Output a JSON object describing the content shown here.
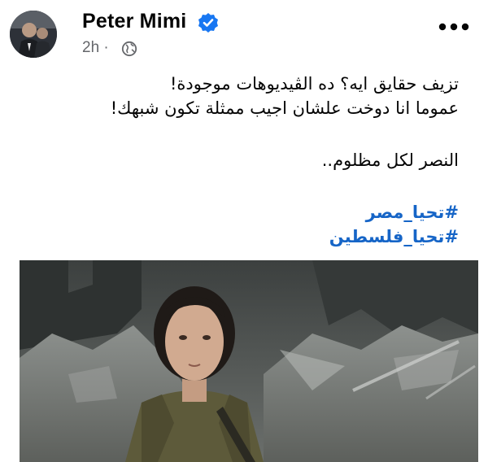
{
  "post": {
    "author_name": "Peter Mimi",
    "time": "2h",
    "separator": "·",
    "lines": [
      "تزيف حقايق ايه؟ ده الڤيديوهات موجودة!",
      "عموما انا دوخت علشان اجيب ممثلة تكون شبهك!"
    ],
    "closing": "النصر لكل مظلوم..",
    "hashtags": [
      "#تحيا_مصر",
      "#تحيا_فلسطين"
    ]
  },
  "icons": {
    "verified": "verified-badge-icon",
    "audience": "globe-icon",
    "more": "more-options-icon"
  },
  "colors": {
    "verified": "#1877f2",
    "hashtag": "#1665c7",
    "meta": "#65676b"
  }
}
